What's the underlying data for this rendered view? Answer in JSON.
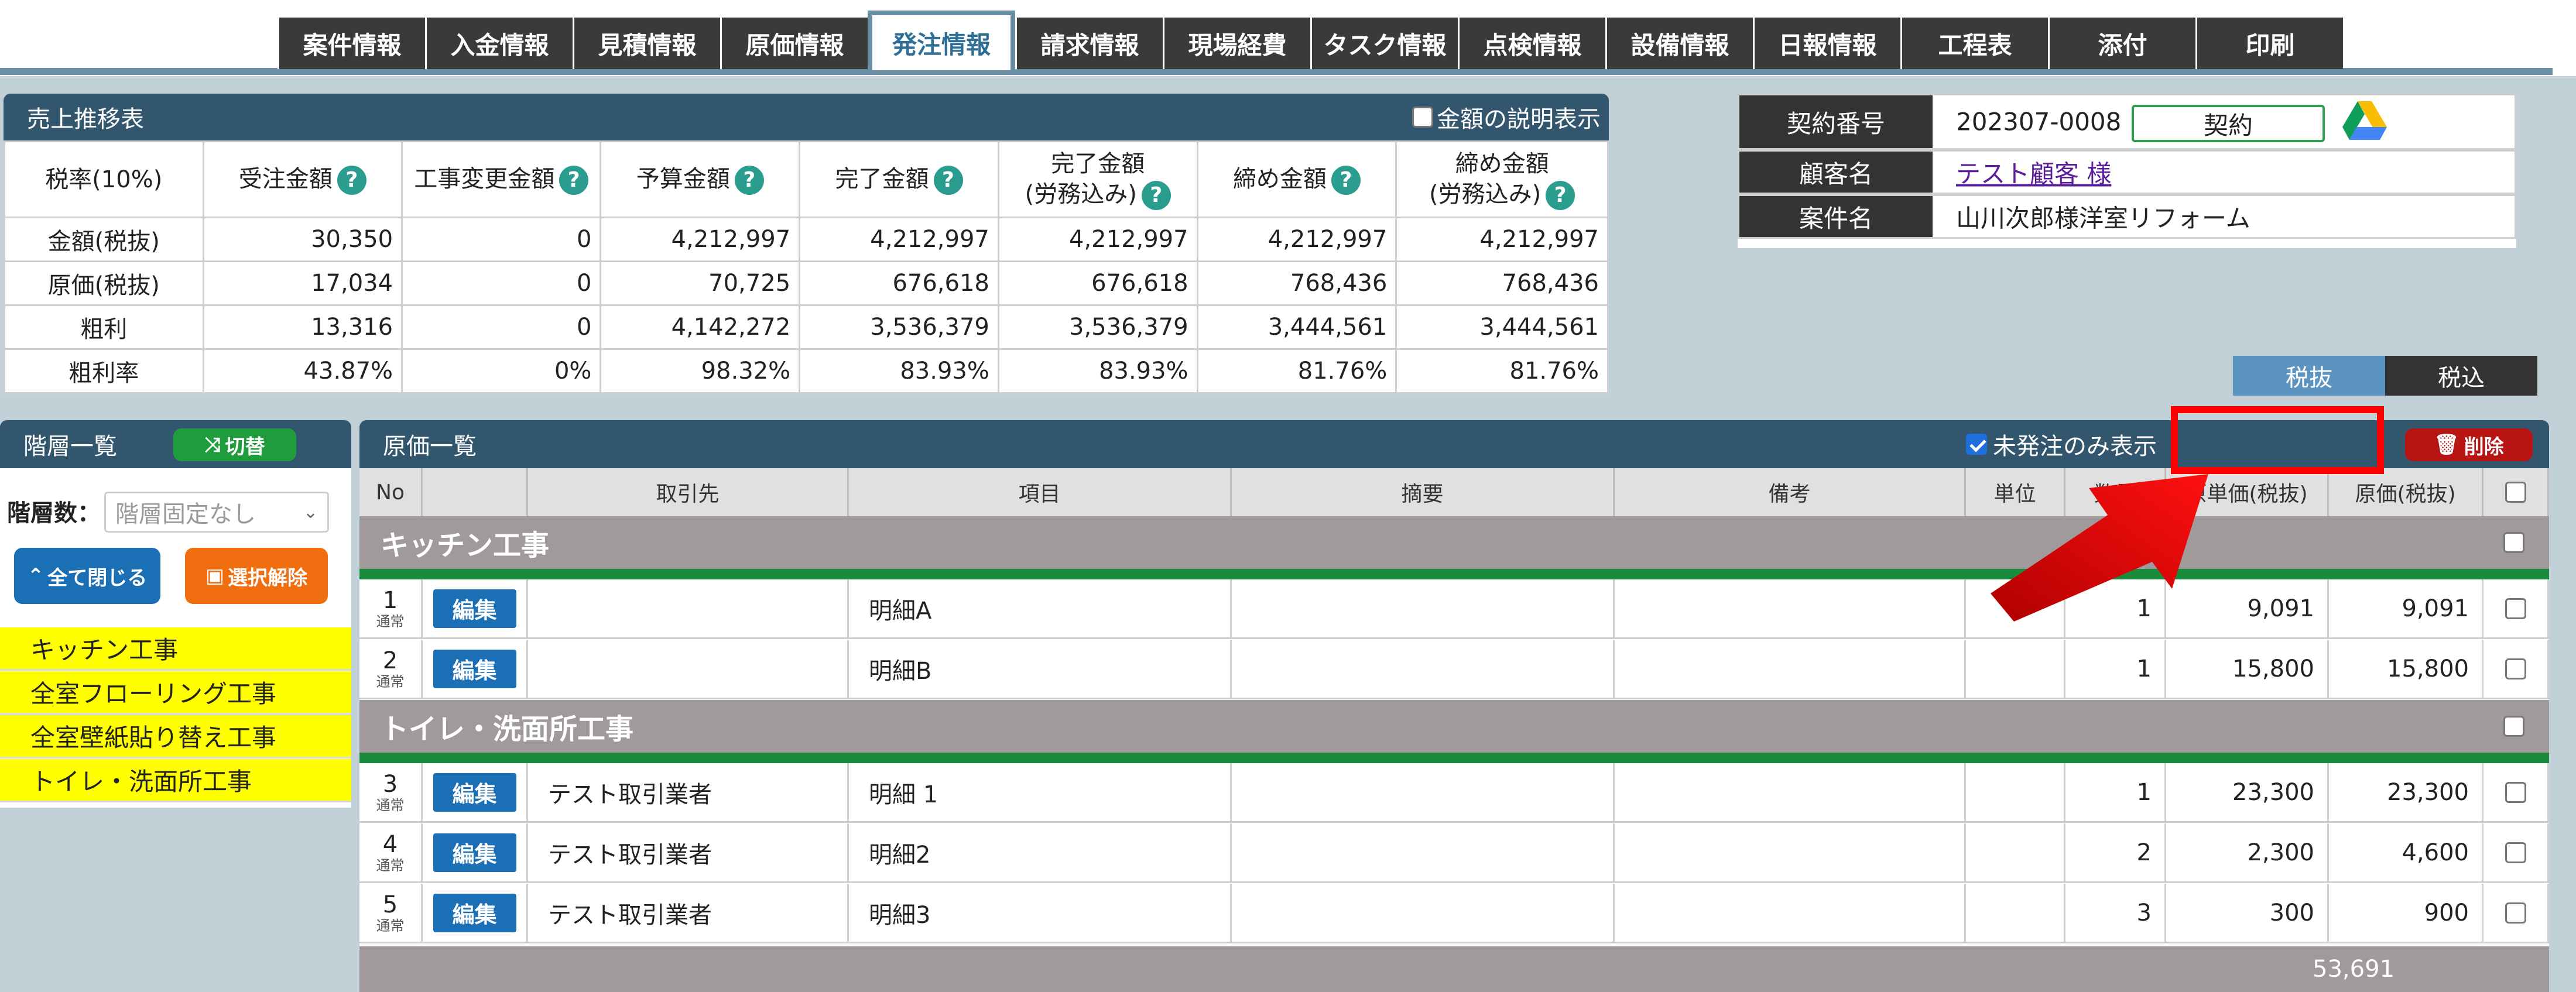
{
  "tabs": [
    {
      "label": "案件情報",
      "active": false
    },
    {
      "label": "入金情報",
      "active": false
    },
    {
      "label": "見積情報",
      "active": false
    },
    {
      "label": "原価情報",
      "active": false
    },
    {
      "label": "発注情報",
      "active": true
    },
    {
      "label": "請求情報",
      "active": false
    },
    {
      "label": "現場経費",
      "active": false
    },
    {
      "label": "タスク情報",
      "active": false
    },
    {
      "label": "点検情報",
      "active": false
    },
    {
      "label": "設備情報",
      "active": false
    },
    {
      "label": "日報情報",
      "active": false
    },
    {
      "label": "工程表",
      "active": false
    },
    {
      "label": "添付",
      "active": false
    },
    {
      "label": "印刷",
      "active": false
    }
  ],
  "sales": {
    "title": "売上推移表",
    "explain_label": "金額の説明表示",
    "headers": [
      {
        "label": "税率(10%)",
        "help": false
      },
      {
        "label": "受注金額",
        "help": true
      },
      {
        "label": "工事変更金額",
        "help": true
      },
      {
        "label": "予算金額",
        "help": true
      },
      {
        "label": "完了金額",
        "help": true
      },
      {
        "label": "完了金額",
        "label2": "(労務込み)",
        "help": true
      },
      {
        "label": "締め金額",
        "help": true
      },
      {
        "label": "締め金額",
        "label2": "(労務込み)",
        "help": true
      }
    ],
    "rows": [
      [
        "金額(税抜)",
        "30,350",
        "0",
        "4,212,997",
        "4,212,997",
        "4,212,997",
        "4,212,997",
        "4,212,997"
      ],
      [
        "原価(税抜)",
        "17,034",
        "0",
        "70,725",
        "676,618",
        "676,618",
        "768,436",
        "768,436"
      ],
      [
        "粗利",
        "13,316",
        "0",
        "4,142,272",
        "3,536,379",
        "3,536,379",
        "3,444,561",
        "3,444,561"
      ],
      [
        "粗利率",
        "43.87%",
        "0%",
        "98.32%",
        "83.93%",
        "83.93%",
        "81.76%",
        "81.76%"
      ]
    ]
  },
  "contract": {
    "number_label": "契約番号",
    "number": "202307-0008",
    "status": "契約",
    "customer_label": "顧客名",
    "customer": "テスト顧客 様",
    "project_label": "案件名",
    "project": "山川次郎様洋室リフォーム",
    "tax_excl": "税抜",
    "tax_incl": "税込"
  },
  "hierarchy": {
    "title": "階層一覧",
    "toggle_label": "切替",
    "level_label": "階層数：",
    "level_placeholder": "階層固定なし",
    "collapse_label": "全て閉じる",
    "deselect_label": "選択解除",
    "items": [
      "キッチン工事",
      "全室フローリング工事",
      "全室壁紙貼り替え工事",
      "トイレ・洗面所工事"
    ]
  },
  "cost": {
    "title": "原価一覧",
    "unordered_only_label": "未発注のみ表示",
    "unordered_only_checked": true,
    "delete_label": "削除",
    "columns": [
      "No",
      "",
      "取引先",
      "項目",
      "摘要",
      "備考",
      "単位",
      "数量",
      "原単価(税抜)",
      "原価(税抜)"
    ],
    "edit_label": "編集",
    "row_sub": "通常",
    "groups": [
      {
        "name": "キッチン工事",
        "rows": [
          {
            "no": "1",
            "vendor": "",
            "item": "明細A",
            "qty": "1",
            "unit_price": "9,091",
            "cost": "9,091"
          },
          {
            "no": "2",
            "vendor": "",
            "item": "明細B",
            "qty": "1",
            "unit_price": "15,800",
            "cost": "15,800"
          }
        ]
      },
      {
        "name": "トイレ・洗面所工事",
        "rows": [
          {
            "no": "3",
            "vendor": "テスト取引業者",
            "item": "明細 1",
            "qty": "1",
            "unit_price": "23,300",
            "cost": "23,300"
          },
          {
            "no": "4",
            "vendor": "テスト取引業者",
            "item": "明細2",
            "qty": "2",
            "unit_price": "2,300",
            "cost": "4,600"
          },
          {
            "no": "5",
            "vendor": "テスト取引業者",
            "item": "明細3",
            "qty": "3",
            "unit_price": "300",
            "cost": "900"
          }
        ]
      }
    ],
    "total": "53,691"
  },
  "colors": {
    "header_bg": "#33566f",
    "tab_bg": "#3a3a3a",
    "highlight": "#ff0000",
    "group_line": "#1a8a3c",
    "hierarchy_item": "#ffff00",
    "edit_button": "#1a6fb5",
    "delete_button": "#b81414"
  }
}
